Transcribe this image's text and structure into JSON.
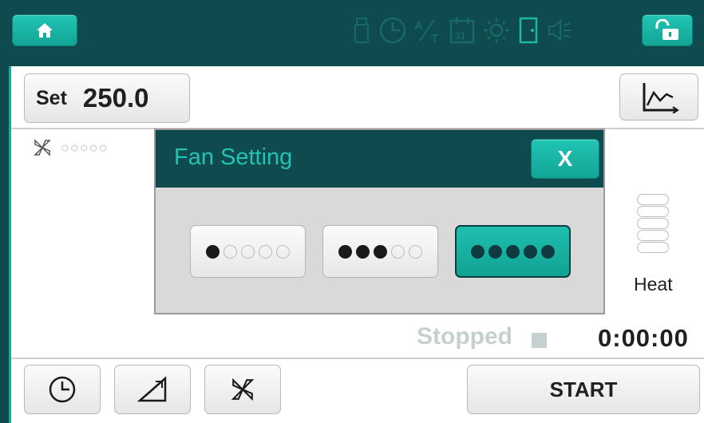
{
  "topbar": {
    "status_icons": [
      "usb-icon",
      "clock-icon",
      "auto-tune-icon",
      "calendar-icon",
      "light-icon",
      "door-icon",
      "speaker-mute-icon"
    ],
    "calendar_day": "31",
    "auto_tune_label": "A/T"
  },
  "setpoint": {
    "label": "Set",
    "value": "250.0"
  },
  "fan": {
    "dots": "○○○○○"
  },
  "heat": {
    "label": "Heat",
    "coils": 5
  },
  "status": {
    "state": "Stopped",
    "timer": "0:00:00"
  },
  "bottom": {
    "start_label": "START"
  },
  "modal": {
    "title": "Fan Setting",
    "close_label": "X",
    "options": [
      {
        "level": 1,
        "of": 5,
        "selected": false
      },
      {
        "level": 3,
        "of": 5,
        "selected": false
      },
      {
        "level": 5,
        "of": 5,
        "selected": true
      }
    ]
  },
  "colors": {
    "accent": "#1aa89a",
    "header": "#0f4a4f",
    "title": "#22c3b3"
  }
}
